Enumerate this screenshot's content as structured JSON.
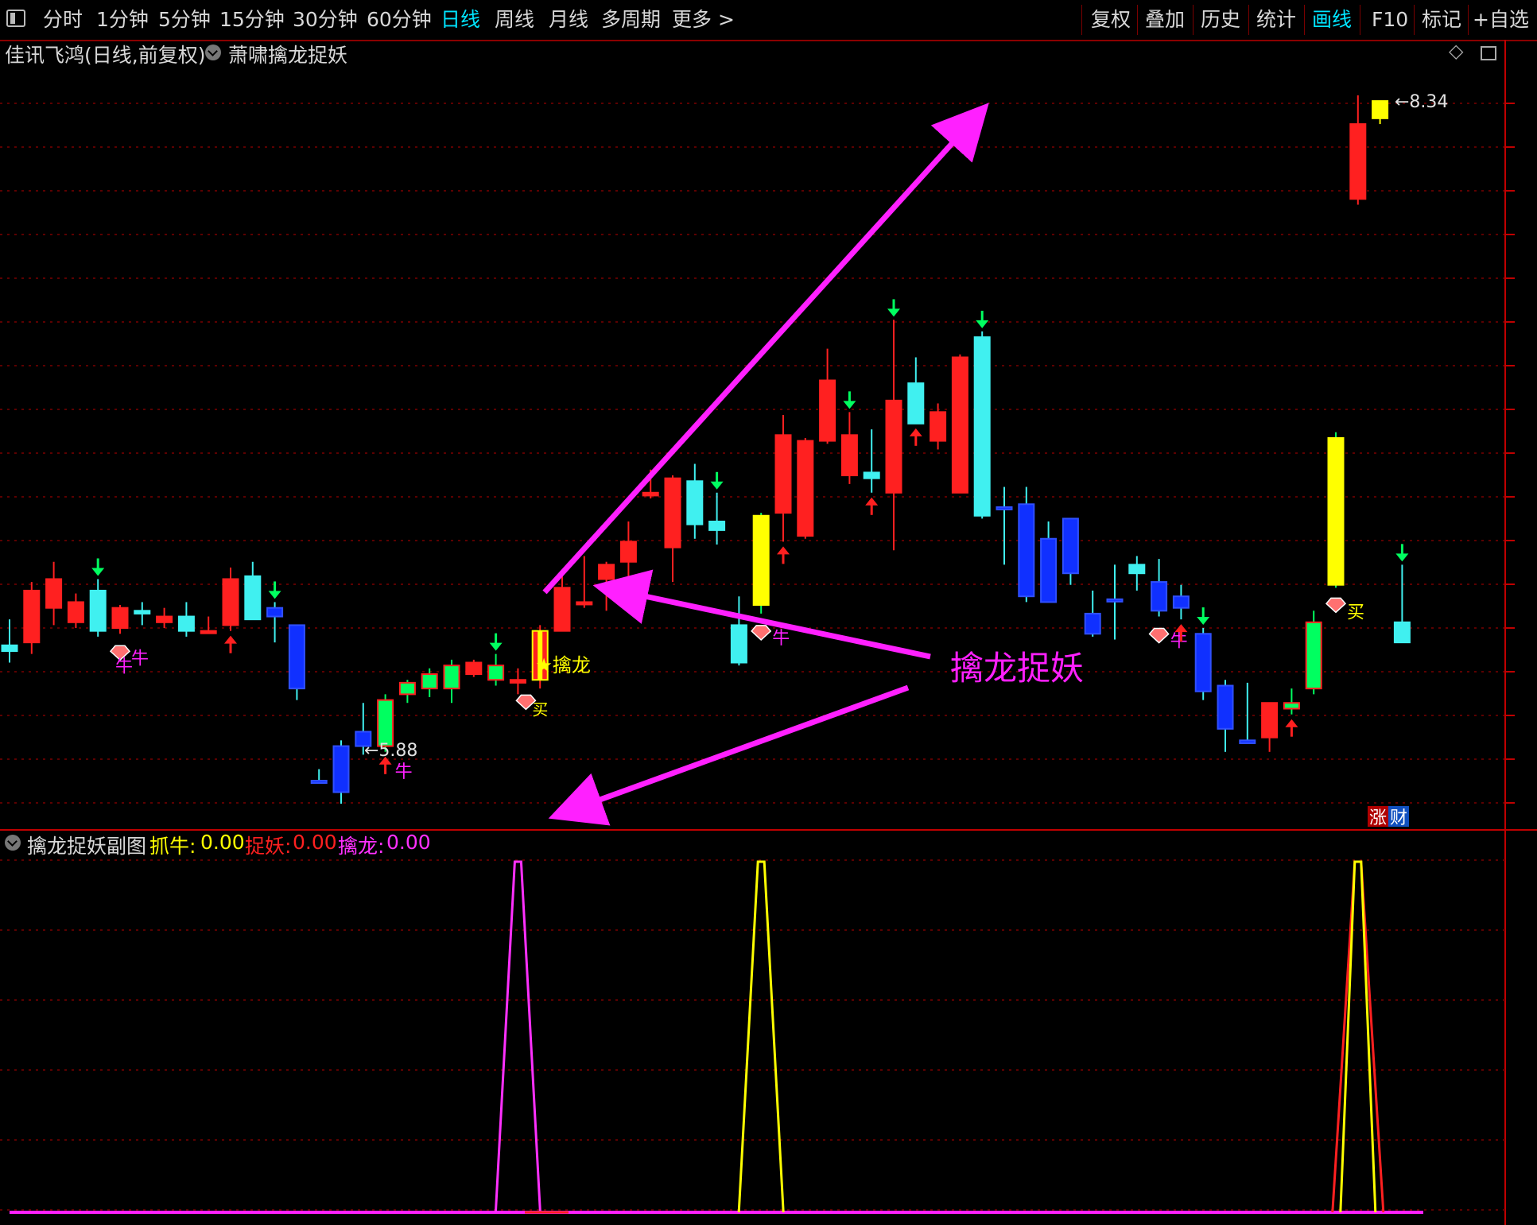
{
  "toolbar": {
    "left_items": [
      "分时",
      "1分钟",
      "5分钟",
      "15分钟",
      "30分钟",
      "60分钟",
      "日线",
      "周线",
      "月线",
      "多周期",
      "更多 >"
    ],
    "active_item": "日线",
    "right_items": [
      "复权",
      "叠加",
      "历史",
      "统计",
      "画线",
      "F10",
      "标记",
      "+自选"
    ],
    "right_active": "画线"
  },
  "main_chart": {
    "stock_title": "佳讯飞鸿(日线,前复权)",
    "indicator_name": "萧啸擒龙捉妖",
    "high_label": "8.34",
    "low_label": "5.88",
    "signal_qinlong": "擒龙",
    "signal_buy": "买",
    "signal_niu": "牛",
    "annotation": "擒龙捉妖",
    "badge_zhang": "涨",
    "badge_cai": "财",
    "colors": {
      "up": "#ff2020",
      "down_cyan": "#40f0f0",
      "blue": "#1030ff",
      "green": "#00ff60",
      "yellow": "#ffff00",
      "magenta": "#ff20ff"
    }
  },
  "sub_chart": {
    "title": "擒龙捉妖副图",
    "items": [
      {
        "label": "抓牛:",
        "value": "0.00",
        "color": "#ffff00"
      },
      {
        "label": "捉妖:",
        "value": "0.00",
        "color": "#ff2020"
      },
      {
        "label": "擒龙:",
        "value": "0.00",
        "color": "#ff30ff"
      }
    ]
  },
  "chart_data": {
    "type": "candlestick",
    "price_range": [
      5.8,
      8.45
    ],
    "candles": [
      {
        "o": 6.43,
        "h": 6.52,
        "l": 6.37,
        "c": 6.41,
        "s": "down_cyan"
      },
      {
        "o": 6.44,
        "h": 6.65,
        "l": 6.4,
        "c": 6.62,
        "s": "up"
      },
      {
        "o": 6.56,
        "h": 6.72,
        "l": 6.5,
        "c": 6.66,
        "s": "up"
      },
      {
        "o": 6.51,
        "h": 6.61,
        "l": 6.49,
        "c": 6.58,
        "s": "up"
      },
      {
        "o": 6.62,
        "h": 6.66,
        "l": 6.46,
        "c": 6.48,
        "s": "down_cyan",
        "sig": "dn"
      },
      {
        "o": 6.49,
        "h": 6.57,
        "l": 6.47,
        "c": 6.56,
        "s": "up",
        "sig": "niu"
      },
      {
        "o": 6.55,
        "h": 6.58,
        "l": 6.5,
        "c": 6.54,
        "s": "down_cyan"
      },
      {
        "o": 6.51,
        "h": 6.56,
        "l": 6.49,
        "c": 6.53,
        "s": "up"
      },
      {
        "o": 6.53,
        "h": 6.58,
        "l": 6.46,
        "c": 6.48,
        "s": "down_cyan"
      },
      {
        "o": 6.48,
        "h": 6.53,
        "l": 6.47,
        "c": 6.48,
        "s": "up"
      },
      {
        "o": 6.5,
        "h": 6.7,
        "l": 6.48,
        "c": 6.66,
        "s": "up",
        "sig": "up"
      },
      {
        "o": 6.67,
        "h": 6.72,
        "l": 6.54,
        "c": 6.52,
        "s": "down_cyan"
      },
      {
        "o": 6.56,
        "h": 6.58,
        "l": 6.44,
        "c": 6.53,
        "s": "blue",
        "sig": "dn"
      },
      {
        "o": 6.5,
        "h": 6.5,
        "l": 6.24,
        "c": 6.28,
        "s": "blue"
      },
      {
        "o": 5.96,
        "h": 6.0,
        "l": 5.95,
        "c": 5.96,
        "s": "blue"
      },
      {
        "o": 6.08,
        "h": 6.1,
        "l": 5.88,
        "c": 5.92,
        "s": "blue"
      },
      {
        "o": 6.08,
        "h": 6.23,
        "l": 6.05,
        "c": 6.13,
        "s": "blue"
      },
      {
        "o": 6.08,
        "h": 6.26,
        "l": 6.06,
        "c": 6.24,
        "s": "green",
        "sig": "up_niu"
      },
      {
        "o": 6.26,
        "h": 6.31,
        "l": 6.23,
        "c": 6.3,
        "s": "green"
      },
      {
        "o": 6.28,
        "h": 6.35,
        "l": 6.25,
        "c": 6.33,
        "s": "green"
      },
      {
        "o": 6.28,
        "h": 6.38,
        "l": 6.23,
        "c": 6.36,
        "s": "green"
      },
      {
        "o": 6.33,
        "h": 6.38,
        "l": 6.32,
        "c": 6.37,
        "s": "up"
      },
      {
        "o": 6.36,
        "h": 6.4,
        "l": 6.29,
        "c": 6.31,
        "s": "green",
        "sig": "dn"
      },
      {
        "o": 6.3,
        "h": 6.35,
        "l": 6.26,
        "c": 6.31,
        "s": "up",
        "sig": "qinlong"
      },
      {
        "o": 6.31,
        "h": 6.5,
        "l": 6.28,
        "c": 6.48,
        "s": "yellow_red"
      },
      {
        "o": 6.48,
        "h": 6.68,
        "l": 6.48,
        "c": 6.63,
        "s": "up"
      },
      {
        "o": 6.58,
        "h": 6.74,
        "l": 6.56,
        "c": 6.58,
        "s": "up"
      },
      {
        "o": 6.66,
        "h": 6.72,
        "l": 6.55,
        "c": 6.71,
        "s": "up"
      },
      {
        "o": 6.72,
        "h": 6.86,
        "l": 6.64,
        "c": 6.79,
        "s": "up"
      },
      {
        "o": 6.95,
        "h": 7.04,
        "l": 6.94,
        "c": 6.96,
        "s": "up"
      },
      {
        "o": 6.77,
        "h": 7.02,
        "l": 6.65,
        "c": 7.01,
        "s": "up"
      },
      {
        "o": 7.0,
        "h": 7.06,
        "l": 6.8,
        "c": 6.85,
        "s": "down_cyan"
      },
      {
        "o": 6.86,
        "h": 6.96,
        "l": 6.78,
        "c": 6.83,
        "s": "down_cyan",
        "sig": "dn"
      },
      {
        "o": 6.5,
        "h": 6.6,
        "l": 6.36,
        "c": 6.37,
        "s": "down_cyan"
      },
      {
        "o": 6.57,
        "h": 6.89,
        "l": 6.54,
        "c": 6.88,
        "s": "yellow",
        "sig": "niu"
      },
      {
        "o": 6.89,
        "h": 7.23,
        "l": 6.79,
        "c": 7.16,
        "s": "up",
        "sig": "up"
      },
      {
        "o": 6.81,
        "h": 7.15,
        "l": 6.8,
        "c": 7.14,
        "s": "up"
      },
      {
        "o": 7.14,
        "h": 7.46,
        "l": 7.13,
        "c": 7.35,
        "s": "up"
      },
      {
        "o": 7.02,
        "h": 7.24,
        "l": 6.99,
        "c": 7.16,
        "s": "up",
        "sig": "dn"
      },
      {
        "o": 7.01,
        "h": 7.18,
        "l": 6.96,
        "c": 7.03,
        "s": "down_cyan",
        "sig": "up"
      },
      {
        "o": 6.96,
        "h": 7.56,
        "l": 6.76,
        "c": 7.28,
        "s": "up",
        "sig": "dn"
      },
      {
        "o": 7.34,
        "h": 7.43,
        "l": 7.2,
        "c": 7.2,
        "s": "down_cyan",
        "sig": "up"
      },
      {
        "o": 7.14,
        "h": 7.27,
        "l": 7.11,
        "c": 7.24,
        "s": "up"
      },
      {
        "o": 6.96,
        "h": 7.44,
        "l": 6.96,
        "c": 7.43,
        "s": "up"
      },
      {
        "o": 7.5,
        "h": 7.52,
        "l": 6.87,
        "c": 6.88,
        "s": "down_cyan",
        "sig": "dn"
      },
      {
        "o": 6.91,
        "h": 6.98,
        "l": 6.71,
        "c": 6.91,
        "s": "blue"
      },
      {
        "o": 6.92,
        "h": 6.98,
        "l": 6.58,
        "c": 6.6,
        "s": "blue"
      },
      {
        "o": 6.8,
        "h": 6.86,
        "l": 6.58,
        "c": 6.58,
        "s": "blue"
      },
      {
        "o": 6.87,
        "h": 6.87,
        "l": 6.64,
        "c": 6.68,
        "s": "blue"
      },
      {
        "o": 6.54,
        "h": 6.62,
        "l": 6.46,
        "c": 6.47,
        "s": "blue"
      },
      {
        "o": 6.59,
        "h": 6.71,
        "l": 6.45,
        "c": 6.59,
        "s": "blue"
      },
      {
        "o": 6.71,
        "h": 6.74,
        "l": 6.62,
        "c": 6.68,
        "s": "down_cyan"
      },
      {
        "o": 6.65,
        "h": 6.73,
        "l": 6.53,
        "c": 6.55,
        "s": "blue",
        "sig": "niu"
      },
      {
        "o": 6.6,
        "h": 6.64,
        "l": 6.52,
        "c": 6.56,
        "s": "blue",
        "sig": "up"
      },
      {
        "o": 6.47,
        "h": 6.49,
        "l": 6.24,
        "c": 6.27,
        "s": "blue",
        "sig": "dn"
      },
      {
        "o": 6.29,
        "h": 6.31,
        "l": 6.06,
        "c": 6.14,
        "s": "blue"
      },
      {
        "o": 6.1,
        "h": 6.3,
        "l": 6.09,
        "c": 6.09,
        "s": "blue"
      },
      {
        "o": 6.11,
        "h": 6.22,
        "l": 6.06,
        "c": 6.23,
        "s": "up"
      },
      {
        "o": 6.23,
        "h": 6.28,
        "l": 6.19,
        "c": 6.21,
        "s": "green",
        "sig": "up"
      },
      {
        "o": 6.28,
        "h": 6.55,
        "l": 6.26,
        "c": 6.51,
        "s": "green"
      },
      {
        "o": 6.64,
        "h": 7.17,
        "l": 6.63,
        "c": 7.15,
        "s": "yellow",
        "sig": "buy"
      },
      {
        "o": 7.98,
        "h": 8.34,
        "l": 7.96,
        "c": 8.24,
        "s": "up"
      },
      {
        "o": 8.26,
        "h": 8.32,
        "l": 8.24,
        "c": 8.32,
        "s": "yellow_top"
      },
      {
        "o": 6.51,
        "h": 6.71,
        "l": 6.44,
        "c": 6.44,
        "s": "down_cyan",
        "sig": "dn"
      }
    ],
    "sub_series": {
      "qinlong": [
        {
          "x": 23,
          "v": 1
        }
      ],
      "zhuaniu": [
        {
          "x": 34,
          "v": 1
        }
      ],
      "zhuoyao_red": [
        {
          "x": 61,
          "v": 1
        }
      ],
      "zhuaniu_2": [
        {
          "x": 61,
          "v": 1
        }
      ]
    }
  }
}
